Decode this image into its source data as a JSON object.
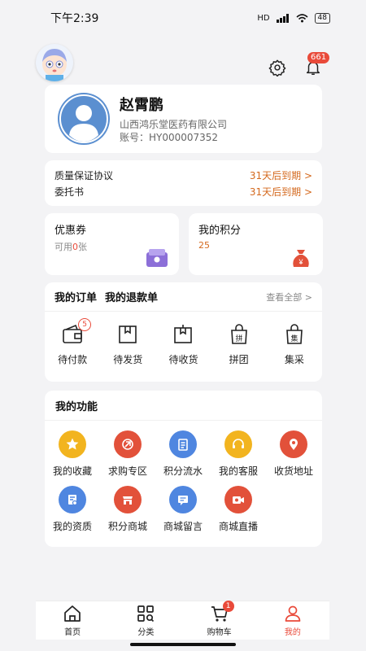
{
  "status": {
    "time": "下午2:39",
    "network": "HD",
    "battery": "48"
  },
  "header": {
    "notification_count": "661"
  },
  "profile": {
    "name": "赵霄鹏",
    "company": "山西鸿乐堂医药有限公司",
    "account": "账号：HY000007352"
  },
  "agreements": [
    {
      "label": "质量保证协议",
      "status": "31天后到期 >"
    },
    {
      "label": "委托书",
      "status": "31天后到期 >"
    }
  ],
  "coupon": {
    "title": "优惠券",
    "prefix": "可用",
    "count": "0",
    "suffix": "张"
  },
  "points": {
    "title": "我的积分",
    "value": "25"
  },
  "orders": {
    "tab_orders": "我的订单",
    "tab_refunds": "我的退款单",
    "view_all": "查看全部 >",
    "items": [
      {
        "label": "待付款",
        "badge": "5",
        "icon": "wallet-icon"
      },
      {
        "label": "待发货",
        "icon": "box-icon"
      },
      {
        "label": "待收货",
        "icon": "delivery-icon"
      },
      {
        "label": "拼团",
        "icon": "group-buy-icon"
      },
      {
        "label": "集采",
        "icon": "bulk-buy-icon"
      }
    ]
  },
  "functions": {
    "title": "我的功能",
    "items": [
      {
        "label": "我的收藏",
        "icon": "star-icon",
        "color": "#f2b41f"
      },
      {
        "label": "求购专区",
        "icon": "purchase-request-icon",
        "color": "#e2513a"
      },
      {
        "label": "积分流水",
        "icon": "points-ledger-icon",
        "color": "#4f86e0"
      },
      {
        "label": "我的客服",
        "icon": "customer-service-icon",
        "color": "#f2b41f"
      },
      {
        "label": "收货地址",
        "icon": "location-icon",
        "color": "#e2513a"
      },
      {
        "label": "我的资质",
        "icon": "qualification-icon",
        "color": "#4f86e0"
      },
      {
        "label": "积分商城",
        "icon": "points-mall-icon",
        "color": "#e2513a"
      },
      {
        "label": "商城留言",
        "icon": "message-board-icon",
        "color": "#4f86e0"
      },
      {
        "label": "商城直播",
        "icon": "live-stream-icon",
        "color": "#e2513a"
      }
    ]
  },
  "tabbar": {
    "items": [
      {
        "label": "首页",
        "icon": "home-icon"
      },
      {
        "label": "分类",
        "icon": "category-icon"
      },
      {
        "label": "购物车",
        "icon": "cart-icon",
        "badge": "1"
      },
      {
        "label": "我的",
        "icon": "user-icon",
        "active": true
      }
    ]
  },
  "colors": {
    "accent": "#e94a3a",
    "warning": "#d4691e",
    "blue": "#4f86e0",
    "gold": "#f2b41f"
  }
}
